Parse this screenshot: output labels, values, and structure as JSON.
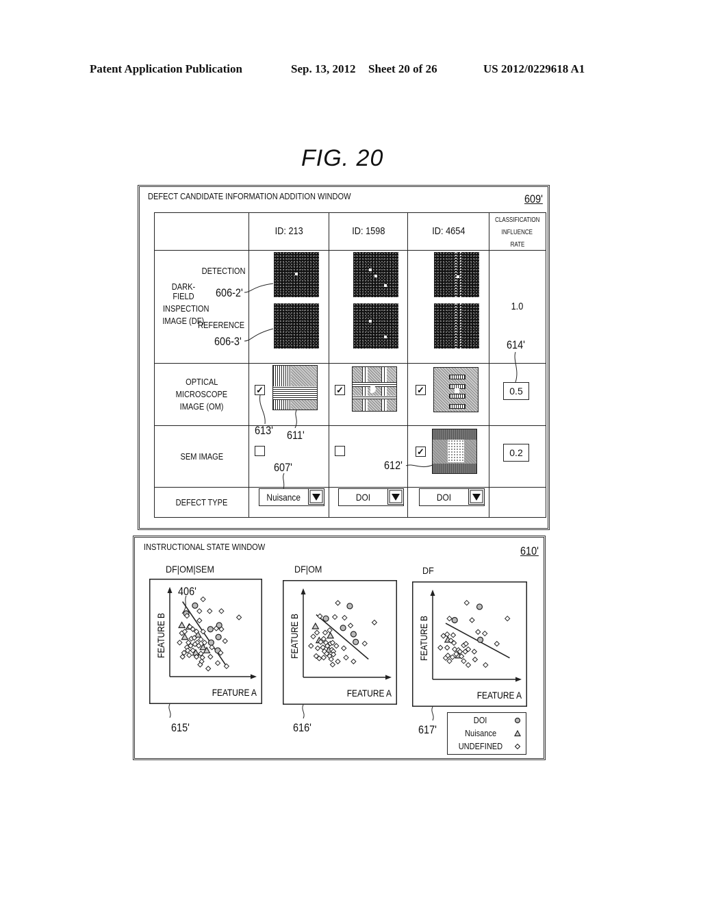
{
  "header": {
    "publication": "Patent Application Publication",
    "date": "Sep. 13, 2012",
    "sheet": "Sheet 20 of 26",
    "number": "US 2012/0229618 A1"
  },
  "figure": {
    "title": "FIG. 20"
  },
  "defect_window": {
    "title": "DEFECT CANDIDATE INFORMATION ADDITION WINDOW",
    "ref": "609'",
    "columns": [
      "ID: 213",
      "ID: 1598",
      "ID: 4654"
    ],
    "rate_header": [
      "CLASSIFICATION",
      "INFLUENCE",
      "RATE"
    ],
    "rows": {
      "df": {
        "label": [
          "DARK-FIELD",
          "INSPECTION",
          "IMAGE (DF)"
        ],
        "detection_label": "DETECTION",
        "reference_label": "REFERENCE",
        "detection_ref": "606-2'",
        "reference_ref": "606-3'",
        "rate": "1.0"
      },
      "om": {
        "label": [
          "OPTICAL",
          "MICROSCOPE",
          "IMAGE (OM)"
        ],
        "checked": [
          true,
          true,
          true
        ],
        "rate": "0.5",
        "rate_ref": "614'",
        "checkbox_ref": "613'",
        "image_ref": "611'"
      },
      "sem": {
        "label": "SEM IMAGE",
        "checked": [
          false,
          false,
          true
        ],
        "rate": "0.2",
        "image_ref": "612'"
      },
      "defect_type": {
        "label": "DEFECT TYPE",
        "values": [
          "Nuisance",
          "DOI",
          "DOI"
        ],
        "dropdown_ref": "607'"
      }
    },
    "check_glyph": "✓"
  },
  "state_window": {
    "title": "INSTRUCTIONAL STATE WINDOW",
    "ref": "610'",
    "boundary_ref": "406'",
    "legend": [
      {
        "label": "DOI",
        "symbol": "circle"
      },
      {
        "label": "Nuisance",
        "symbol": "triangle"
      },
      {
        "label": "UNDEFINED",
        "symbol": "diamond"
      }
    ]
  },
  "chart_data": [
    {
      "type": "scatter",
      "title": "DF|OM|SEM",
      "ref": "615'",
      "xlabel": "FEATURE A",
      "ylabel": "FEATURE B",
      "xlim": [
        0,
        100
      ],
      "ylim": [
        0,
        100
      ],
      "boundary": [
        [
          10,
          90
        ],
        [
          70,
          8
        ]
      ],
      "series": [
        {
          "name": "DOI",
          "symbol": "circle",
          "points": [
            [
              27,
              85
            ],
            [
              15,
              75
            ],
            [
              48,
              55
            ],
            [
              49,
              38
            ],
            [
              59,
              45
            ],
            [
              60,
              60
            ],
            [
              58,
              28
            ]
          ]
        },
        {
          "name": "Nuisance",
          "symbol": "triangle",
          "points": [
            [
              9,
              60
            ],
            [
              19,
              58
            ],
            [
              13,
              45
            ],
            [
              31,
              48
            ],
            [
              38,
              32
            ],
            [
              43,
              28
            ],
            [
              28,
              25
            ]
          ]
        },
        {
          "name": "UNDEFINED",
          "symbol": "diamond",
          "points": [
            [
              38,
              93
            ],
            [
              16,
              72
            ],
            [
              33,
              78
            ],
            [
              47,
              78
            ],
            [
              63,
              78
            ],
            [
              33,
              66
            ],
            [
              87,
              70
            ],
            [
              20,
              58
            ],
            [
              9,
              50
            ],
            [
              13,
              52
            ],
            [
              24,
              55
            ],
            [
              29,
              52
            ],
            [
              38,
              52
            ],
            [
              56,
              56
            ],
            [
              63,
              55
            ],
            [
              6,
              38
            ],
            [
              18,
              38
            ],
            [
              22,
              43
            ],
            [
              26,
              44
            ],
            [
              30,
              38
            ],
            [
              35,
              42
            ],
            [
              16,
              32
            ],
            [
              21,
              34
            ],
            [
              27,
              36
            ],
            [
              32,
              34
            ],
            [
              40,
              38
            ],
            [
              50,
              32
            ],
            [
              12,
              25
            ],
            [
              17,
              28
            ],
            [
              24,
              28
            ],
            [
              35,
              24
            ],
            [
              10,
              20
            ],
            [
              19,
              22
            ],
            [
              29,
              20
            ],
            [
              37,
              19
            ],
            [
              48,
              20
            ],
            [
              62,
              25
            ],
            [
              68,
              40
            ],
            [
              58,
              12
            ],
            [
              36,
              14
            ],
            [
              34,
              10
            ],
            [
              45,
              5
            ],
            [
              70,
              8
            ]
          ]
        }
      ]
    },
    {
      "type": "scatter",
      "title": "DF|OM",
      "ref": "616'",
      "xlabel": "FEATURE A",
      "ylabel": "FEATURE B",
      "xlim": [
        0,
        100
      ],
      "ylim": [
        0,
        100
      ],
      "boundary": [
        [
          10,
          75
        ],
        [
          80,
          18
        ]
      ],
      "series": [
        {
          "name": "DOI",
          "symbol": "circle",
          "points": [
            [
              55,
              86
            ],
            [
              23,
              70
            ],
            [
              46,
              58
            ],
            [
              60,
              50
            ],
            [
              63,
              40
            ]
          ]
        },
        {
          "name": "Nuisance",
          "symbol": "triangle",
          "points": [
            [
              9,
              60
            ],
            [
              14,
              42
            ],
            [
              29,
              48
            ],
            [
              27,
              30
            ]
          ]
        },
        {
          "name": "UNDEFINED",
          "symbol": "diamond",
          "points": [
            [
              39,
              90
            ],
            [
              15,
              73
            ],
            [
              35,
              72
            ],
            [
              48,
              71
            ],
            [
              88,
              65
            ],
            [
              56,
              61
            ],
            [
              11,
              52
            ],
            [
              6,
              47
            ],
            [
              22,
              52
            ],
            [
              28,
              55
            ],
            [
              16,
              40
            ],
            [
              20,
              44
            ],
            [
              23,
              39
            ],
            [
              25,
              35
            ],
            [
              29,
              38
            ],
            [
              32,
              39
            ],
            [
              3,
              35
            ],
            [
              12,
              32
            ],
            [
              19,
              33
            ],
            [
              21,
              28
            ],
            [
              24,
              25
            ],
            [
              31,
              30
            ],
            [
              33,
              28
            ],
            [
              37,
              35
            ],
            [
              47,
              32
            ],
            [
              10,
              22
            ],
            [
              14,
              19
            ],
            [
              20,
              20
            ],
            [
              28,
              22
            ],
            [
              33,
              24
            ],
            [
              39,
              15
            ],
            [
              30,
              18
            ],
            [
              50,
              20
            ],
            [
              75,
              38
            ],
            [
              60,
              15
            ],
            [
              32,
              11
            ]
          ]
        }
      ]
    },
    {
      "type": "scatter",
      "title": "DF",
      "ref": "617'",
      "xlabel": "FEATURE A",
      "ylabel": "FEATURE B",
      "xlim": [
        0,
        100
      ],
      "ylim": [
        0,
        100
      ],
      "boundary": [
        [
          10,
          66
        ],
        [
          95,
          22
        ]
      ],
      "series": [
        {
          "name": "DOI",
          "symbol": "circle",
          "points": [
            [
              55,
              87
            ],
            [
              22,
              70
            ],
            [
              56,
              45
            ]
          ]
        },
        {
          "name": "Nuisance",
          "symbol": "triangle",
          "points": [
            [
              13,
              45
            ],
            [
              27,
              25
            ]
          ]
        },
        {
          "name": "UNDEFINED",
          "symbol": "diamond",
          "points": [
            [
              38,
              92
            ],
            [
              15,
              72
            ],
            [
              45,
              70
            ],
            [
              92,
              72
            ],
            [
              53,
              55
            ],
            [
              62,
              53
            ],
            [
              78,
              40
            ],
            [
              7,
              50
            ],
            [
              12,
              52
            ],
            [
              20,
              51
            ],
            [
              17,
              44
            ],
            [
              21,
              41
            ],
            [
              3,
              35
            ],
            [
              12,
              35
            ],
            [
              22,
              33
            ],
            [
              27,
              32
            ],
            [
              34,
              38
            ],
            [
              37,
              40
            ],
            [
              40,
              33
            ],
            [
              48,
              30
            ],
            [
              24,
              27
            ],
            [
              29,
              30
            ],
            [
              36,
              30
            ],
            [
              10,
              22
            ],
            [
              13,
              25
            ],
            [
              19,
              23
            ],
            [
              31,
              24
            ],
            [
              34,
              18
            ],
            [
              40,
              13
            ],
            [
              49,
              20
            ],
            [
              15,
              18
            ],
            [
              63,
              13
            ]
          ]
        }
      ]
    }
  ]
}
